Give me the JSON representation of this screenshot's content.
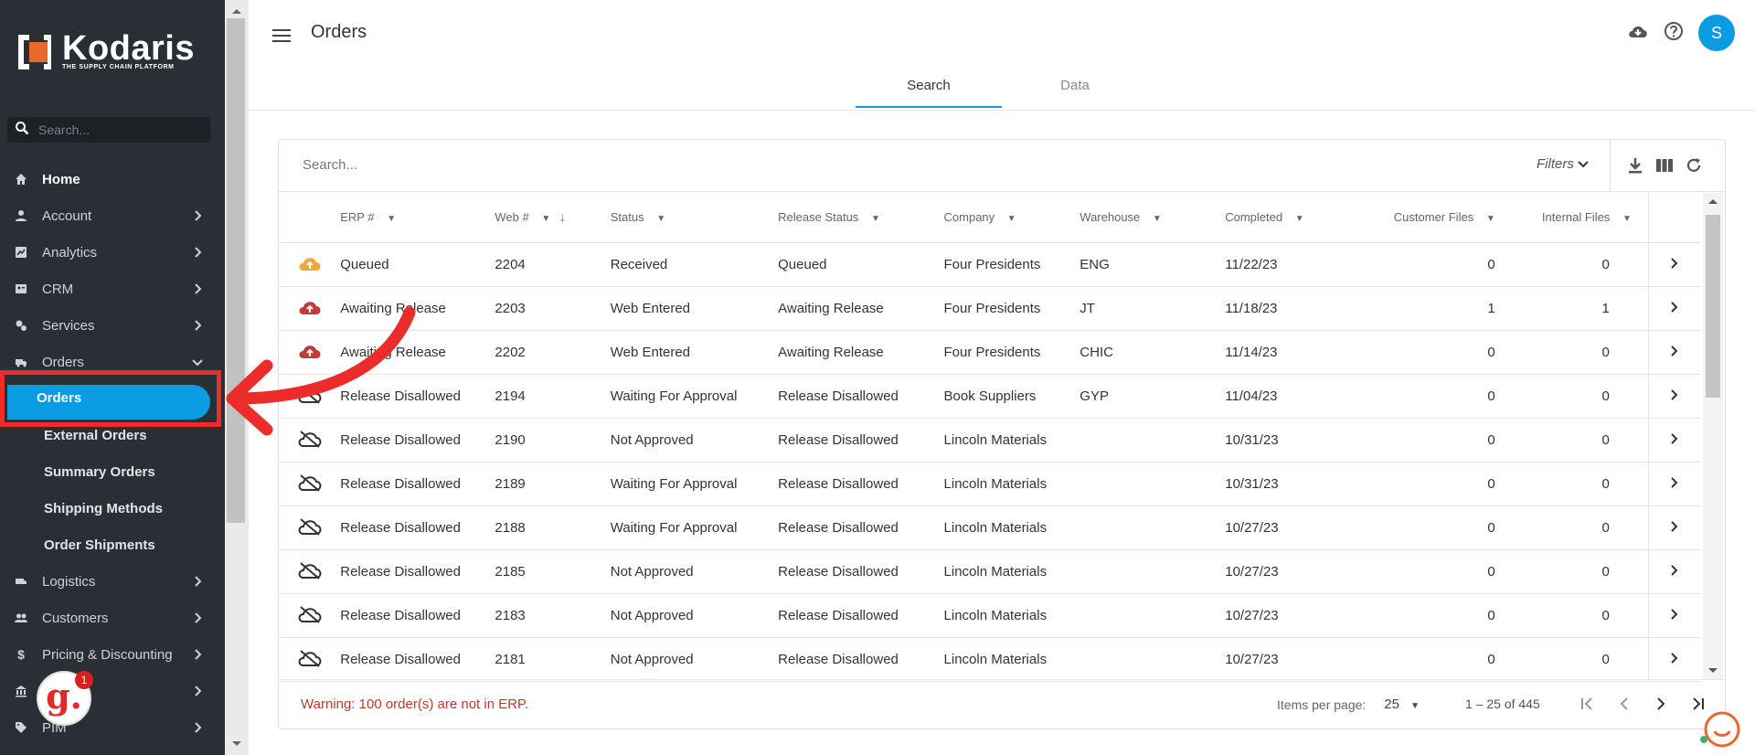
{
  "brand": {
    "name": "Kodaris",
    "tagline": "THE SUPPLY CHAIN PLATFORM",
    "accent": "#0a9be3",
    "sidebar_bg": "#2a2f36",
    "warn_color": "#c0392b"
  },
  "sidebar": {
    "search_placeholder": "Search...",
    "items": [
      {
        "label": "Home",
        "icon": "home-icon"
      },
      {
        "label": "Account",
        "icon": "person-icon"
      },
      {
        "label": "Analytics",
        "icon": "chart-icon"
      },
      {
        "label": "CRM",
        "icon": "contact-card-icon"
      },
      {
        "label": "Services",
        "icon": "gears-icon"
      },
      {
        "label": "Orders",
        "icon": "truck-icon"
      },
      {
        "label": "Logistics",
        "icon": "shipping-icon"
      },
      {
        "label": "Customers",
        "icon": "people-icon"
      },
      {
        "label": "Pricing & Discounting",
        "icon": "dollar-icon"
      },
      {
        "label": "",
        "icon": "bank-icon"
      },
      {
        "label": "PIM",
        "icon": "tag-icon"
      }
    ],
    "orders_sub": [
      "Orders",
      "External Orders",
      "Summary Orders",
      "Shipping Methods",
      "Order Shipments"
    ]
  },
  "header": {
    "title": "Orders",
    "avatar_initial": "S",
    "tabs": [
      "Search",
      "Data"
    ],
    "active_tab": "Search"
  },
  "toolbar": {
    "search_placeholder": "Search...",
    "filters_label": "Filters"
  },
  "table": {
    "columns": [
      "ERP #",
      "Web #",
      "Status",
      "Release Status",
      "Company",
      "Warehouse",
      "Completed",
      "Customer Files",
      "Internal Files"
    ],
    "rows": [
      {
        "icon": "cloud-upload-orange-icon",
        "erp": "Queued",
        "web": "2204",
        "status": "Received",
        "status_red": false,
        "release": "Queued",
        "company": "Four Presidents",
        "warehouse": "ENG",
        "completed": "11/22/23",
        "customer_files": "0",
        "internal_files": "0"
      },
      {
        "icon": "cloud-upload-red-icon",
        "erp": "Awaiting Release",
        "web": "2203",
        "status": "Web Entered",
        "status_red": true,
        "release": "Awaiting Release",
        "company": "Four Presidents",
        "warehouse": "JT",
        "completed": "11/18/23",
        "customer_files": "1",
        "internal_files": "1"
      },
      {
        "icon": "cloud-upload-red-icon",
        "erp": "Awaiting Release",
        "web": "2202",
        "status": "Web Entered",
        "status_red": true,
        "release": "Awaiting Release",
        "company": "Four Presidents",
        "warehouse": "CHIC",
        "completed": "11/14/23",
        "customer_files": "0",
        "internal_files": "0"
      },
      {
        "icon": "cloud-off-icon",
        "erp": "Release Disallowed",
        "web": "2194",
        "status": "Waiting For Approval",
        "status_red": false,
        "release": "Release Disallowed",
        "company": "Book Suppliers",
        "warehouse": "GYP",
        "completed": "11/04/23",
        "customer_files": "0",
        "internal_files": "0"
      },
      {
        "icon": "cloud-off-icon",
        "erp": "Release Disallowed",
        "web": "2190",
        "status": "Not Approved",
        "status_red": false,
        "release": "Release Disallowed",
        "company": "Lincoln Materials",
        "warehouse": "",
        "completed": "10/31/23",
        "customer_files": "0",
        "internal_files": "0"
      },
      {
        "icon": "cloud-off-icon",
        "erp": "Release Disallowed",
        "web": "2189",
        "status": "Waiting For Approval",
        "status_red": false,
        "release": "Release Disallowed",
        "company": "Lincoln Materials",
        "warehouse": "",
        "completed": "10/31/23",
        "customer_files": "0",
        "internal_files": "0"
      },
      {
        "icon": "cloud-off-icon",
        "erp": "Release Disallowed",
        "web": "2188",
        "status": "Waiting For Approval",
        "status_red": false,
        "release": "Release Disallowed",
        "company": "Lincoln Materials",
        "warehouse": "",
        "completed": "10/27/23",
        "customer_files": "0",
        "internal_files": "0"
      },
      {
        "icon": "cloud-off-icon",
        "erp": "Release Disallowed",
        "web": "2185",
        "status": "Not Approved",
        "status_red": false,
        "release": "Release Disallowed",
        "company": "Lincoln Materials",
        "warehouse": "",
        "completed": "10/27/23",
        "customer_files": "0",
        "internal_files": "0"
      },
      {
        "icon": "cloud-off-icon",
        "erp": "Release Disallowed",
        "web": "2183",
        "status": "Not Approved",
        "status_red": false,
        "release": "Release Disallowed",
        "company": "Lincoln Materials",
        "warehouse": "",
        "completed": "10/27/23",
        "customer_files": "0",
        "internal_files": "0"
      },
      {
        "icon": "cloud-off-icon",
        "erp": "Release Disallowed",
        "web": "2181",
        "status": "Not Approved",
        "status_red": false,
        "release": "Release Disallowed",
        "company": "Lincoln Materials",
        "warehouse": "",
        "completed": "10/27/23",
        "customer_files": "0",
        "internal_files": "0"
      }
    ]
  },
  "footer": {
    "warning": "Warning: 100 order(s) are not in ERP.",
    "items_per_page_label": "Items per page:",
    "items_per_page": "25",
    "range": "1 – 25 of 445"
  },
  "grammarly": {
    "letter": "g.",
    "badge": "1"
  }
}
